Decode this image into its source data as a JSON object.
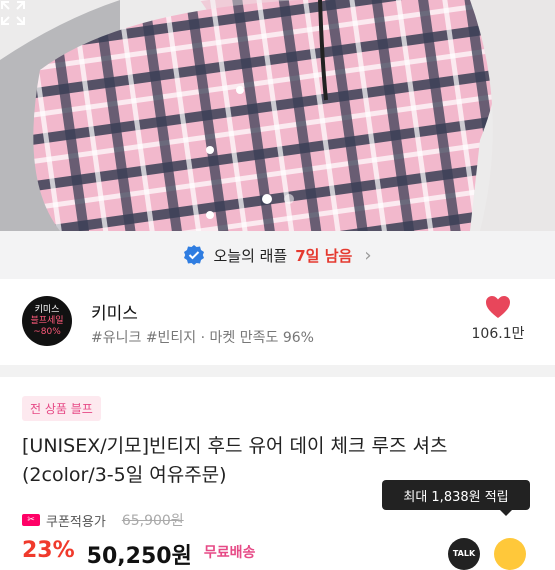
{
  "gallery": {
    "page_count": 2,
    "active_index": 0
  },
  "raffle_banner": {
    "label": "오늘의 래플",
    "remaining": "7일 남음"
  },
  "shop": {
    "logo_line1": "키미스",
    "logo_line2": "블프세일",
    "logo_line3": "~80%",
    "name": "키미스",
    "tags": "#유니크 #빈티지 · 마켓 만족도 96%",
    "likes": "106.1만"
  },
  "product": {
    "badge": "전 상품 블프",
    "title": "[UNISEX/기모]빈티지 후드 유어 데이 체크 루즈 셔츠 (2color/3-5일 여유주문)",
    "coupon_label": "쿠폰적용가",
    "original_price": "65,900원",
    "points_tooltip": "최대 1,838원 적립",
    "discount": "23%",
    "price": "50,250원",
    "shipping": "무료배송",
    "talk_label": "TALK"
  },
  "colors": {
    "accent_red": "#e5392f",
    "pink": "#e64a86",
    "heart": "#e8465b"
  }
}
